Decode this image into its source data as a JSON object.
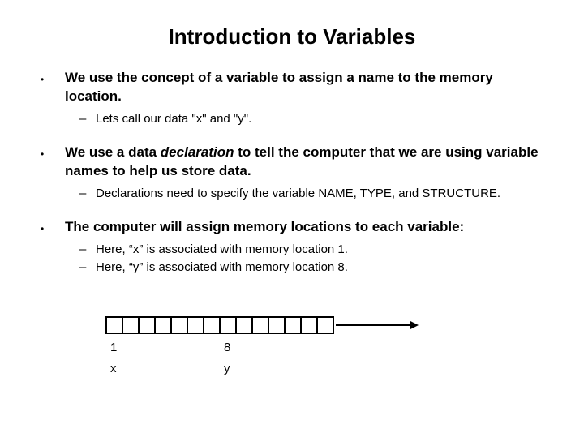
{
  "title": "Introduction to Variables",
  "bullets": [
    {
      "lead_pre": "We use the concept of a variable to assign a name to the memory location.",
      "subs": [
        "Lets call our data \"x\" and \"y\"."
      ]
    },
    {
      "lead_pre": "We use a data ",
      "lead_em": "declaration",
      "lead_post": " to tell the computer that we are using variable names to help us store data.",
      "subs": [
        "Declarations need to specify the variable NAME, TYPE, and STRUCTURE."
      ]
    },
    {
      "lead_pre": "The computer will assign memory locations to each variable:",
      "subs": [
        "Here, “x” is associated with memory location 1.",
        "Here, “y” is associated with memory location 8."
      ]
    }
  ],
  "diagram": {
    "loc1_label": "1",
    "loc2_label": "8",
    "var1_label": "x",
    "var2_label": "y"
  }
}
